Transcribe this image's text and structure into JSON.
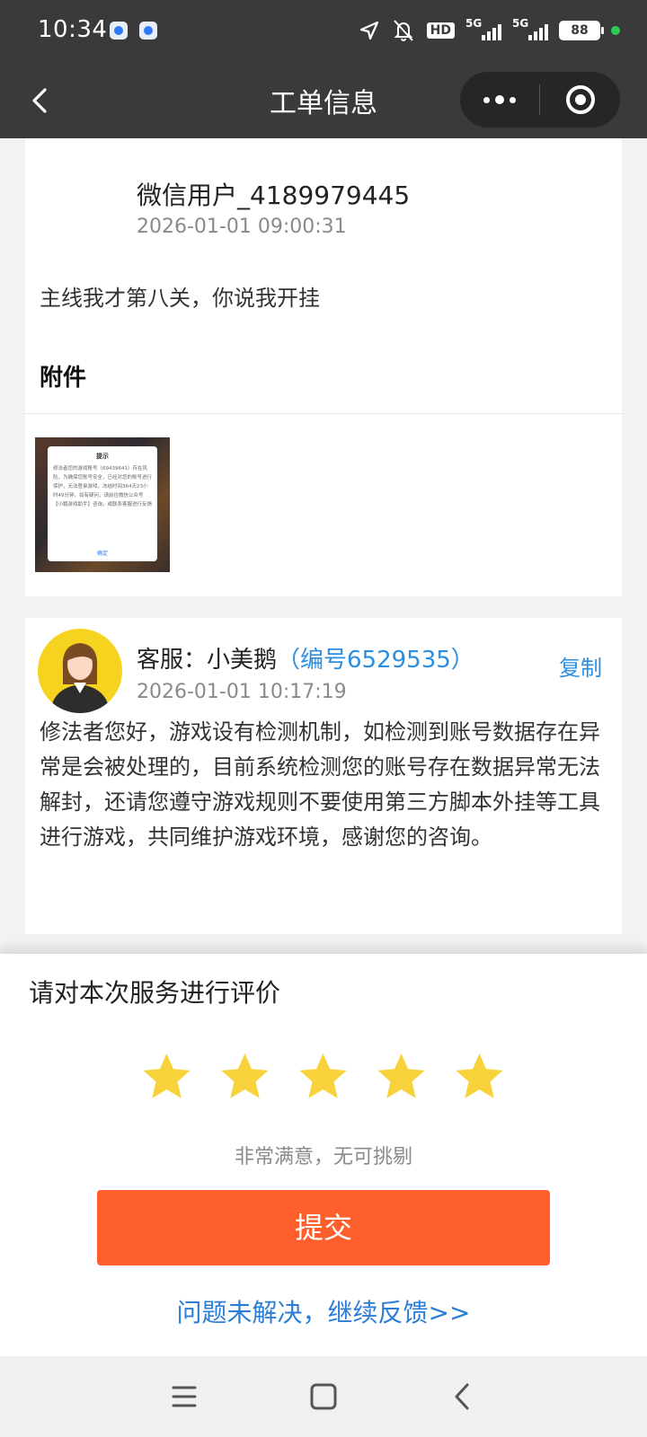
{
  "status_bar": {
    "time": "10:34",
    "hd_label": "HD",
    "net1_label": "5G",
    "net2_label": "5G",
    "battery": "88"
  },
  "nav": {
    "title": "工单信息",
    "back_icon": "chevron-left-icon",
    "more_icon": "more-dots-icon",
    "close_icon": "target-close-icon"
  },
  "ticket": {
    "user_name": "微信用户_4189979445",
    "time": "2026-01-01 09:00:31",
    "message": "主线我才第八关，你说我开挂",
    "attachment_title": "附件",
    "attachment_thumb": {
      "dialog_title": "提示",
      "dialog_body": "修法者您的游戏账号（69439641）存在风险，为确保您账号安全，已经对您的账号进行保护，无法登录游戏，冻结时间364天23小时49分钟，如有疑问，请前往微信公众号【小鹅游戏助手】咨询，或联系客服进行反馈",
      "dialog_ok": "确定"
    }
  },
  "reply": {
    "agent_prefix": "客服：小美鹅",
    "agent_id": "（编号6529535）",
    "copy_label": "复制",
    "time": "2026-01-01 10:17:19",
    "text": "修法者您好，游戏设有检测机制，如检测到账号数据存在异常是会被处理的，目前系统检测您的账号存在数据异常无法解封，还请您遵守游戏规则不要使用第三方脚本外挂等工具进行游戏，共同维护游戏环境，感谢您的咨询。"
  },
  "rating": {
    "title": "请对本次服务进行评价",
    "stars_selected": 5,
    "stars_total": 5,
    "star_color": "#f7d23a",
    "rating_text": "非常满意，无可挑剔",
    "submit_label": "提交",
    "submit_color": "#ff5f2c",
    "feedback_link": "问题未解决，继续反馈>>"
  },
  "system_nav": {
    "menu_icon": "menu-icon",
    "home_icon": "home-square-icon",
    "back_icon": "back-chevron-icon"
  }
}
